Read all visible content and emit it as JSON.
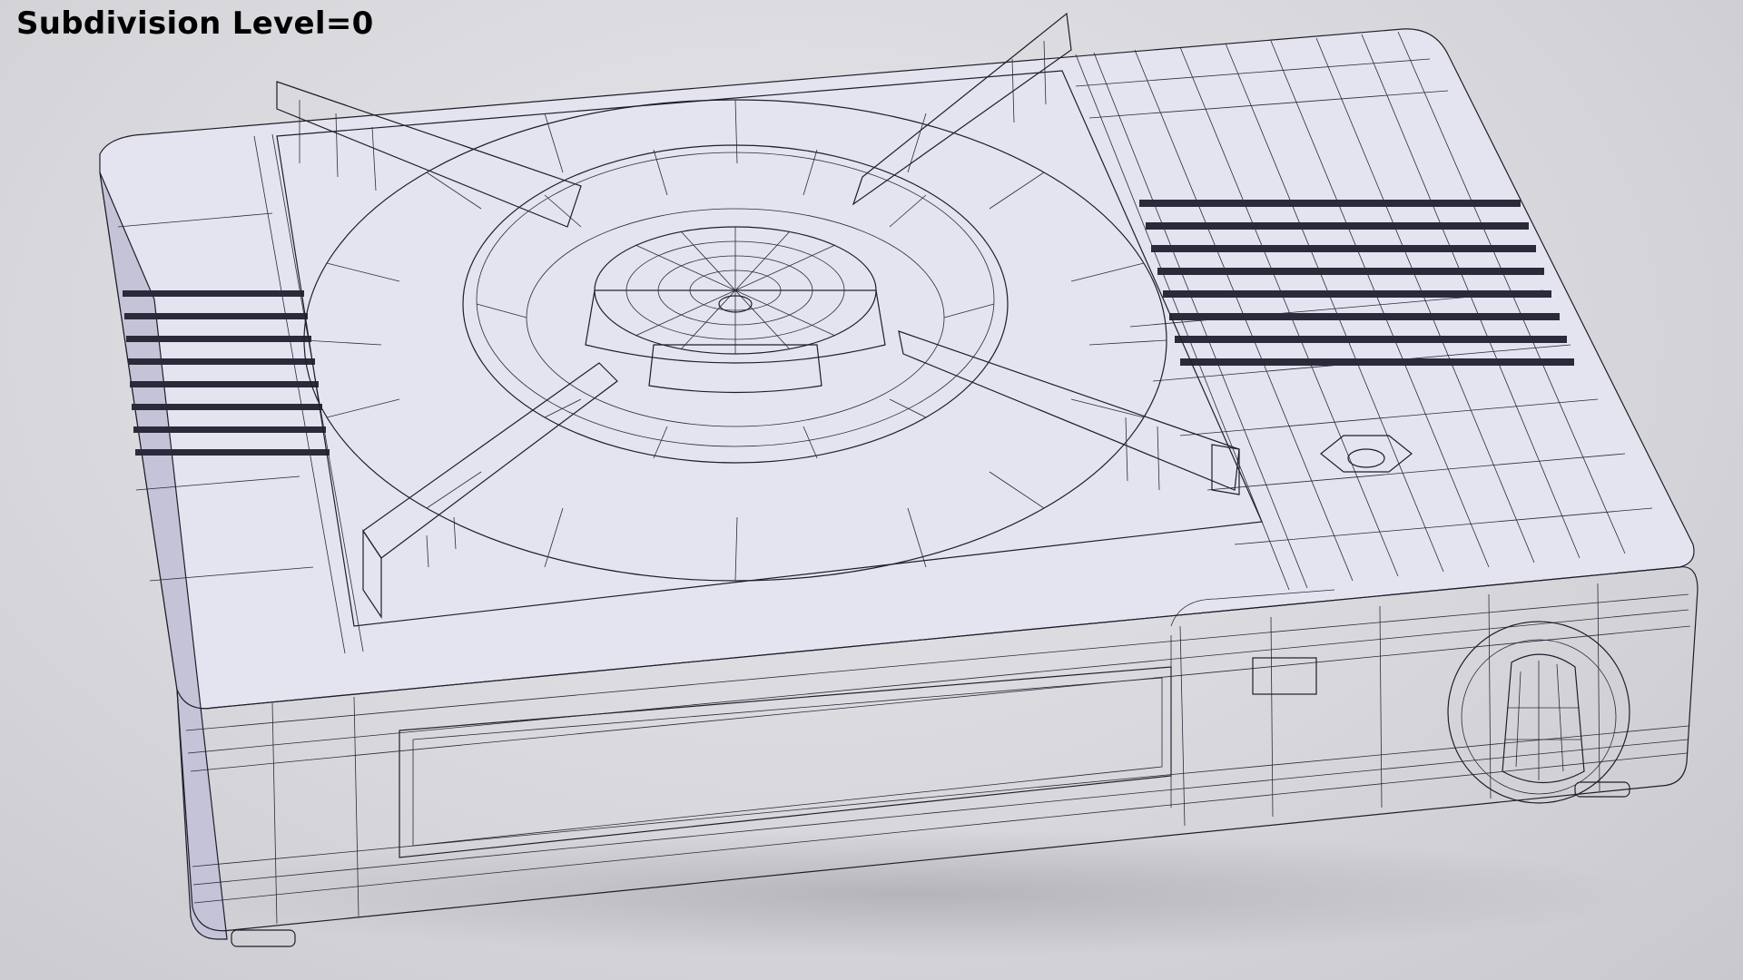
{
  "viewport": {
    "caption": "Subdivision Level=0"
  },
  "model": {
    "icon": "portable-gas-stove-wireframe",
    "colors": {
      "surface": "#e4e3f0",
      "shade": "#c4c3d8",
      "wire": "#1e1e2a",
      "background": "#dcdce0"
    }
  }
}
